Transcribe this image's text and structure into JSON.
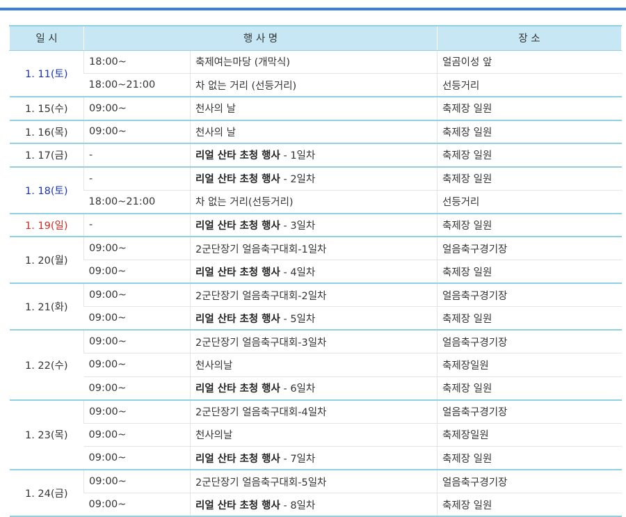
{
  "colors": {
    "header_bg": "#c6e7f3",
    "accent_bar": "#3d7ed6",
    "group_line": "#8fd0e3",
    "saturday": "#1a33bb",
    "sunday": "#d7261e"
  },
  "header": {
    "date": "일 시",
    "event": "행 사 명",
    "place": "장 소"
  },
  "groups": [
    {
      "date": "1. 11(토)",
      "day": "sat",
      "rows": [
        {
          "time": "18:00~",
          "event": "축제여는마당 (개막식)",
          "suffix": "",
          "place": "얼곰이성 앞"
        },
        {
          "time": "18:00~21:00",
          "event": "차 없는 거리 (선등거리)",
          "suffix": "",
          "place": "선등거리"
        }
      ]
    },
    {
      "date": "1. 15(수)",
      "day": "",
      "rows": [
        {
          "time": "09:00~",
          "event": "천사의 날",
          "suffix": "",
          "place": "축제장 일원"
        }
      ]
    },
    {
      "date": "1. 16(목)",
      "day": "",
      "rows": [
        {
          "time": "09:00~",
          "event": "천사의 날",
          "suffix": "",
          "place": "축제장 일원"
        }
      ]
    },
    {
      "date": "1. 17(금)",
      "day": "",
      "rows": [
        {
          "time": "-",
          "event": "리얼 산타 초청 행사",
          "suffix": " - 1일차",
          "place": "축제장 일원"
        }
      ]
    },
    {
      "date": "1. 18(토)",
      "day": "sat",
      "rows": [
        {
          "time": "-",
          "event": "리얼 산타 초청 행사",
          "suffix": " - 2일차",
          "place": "축제장 일원"
        },
        {
          "time": "18:00~21:00",
          "event": "차 없는 거리(선등거리)",
          "suffix": "",
          "place": "선등거리"
        }
      ]
    },
    {
      "date": "1. 19(일)",
      "day": "sun",
      "rows": [
        {
          "time": "-",
          "event": "리얼 산타 초청 행사",
          "suffix": " - 3일차",
          "place": "축제장 일원"
        }
      ]
    },
    {
      "date": "1. 20(월)",
      "day": "",
      "rows": [
        {
          "time": "09:00~",
          "event": "2군단장기 얼음축구대회-1일차",
          "suffix": "",
          "place": "얼음축구경기장"
        },
        {
          "time": "09:00~",
          "event": "리얼 산타 초청 행사",
          "suffix": " - 4일차",
          "place": "축제장 일원"
        }
      ]
    },
    {
      "date": "1. 21(화)",
      "day": "",
      "rows": [
        {
          "time": "09:00~",
          "event": "2군단장기 얼음축구대회-2일차",
          "suffix": "",
          "place": "얼음축구경기장"
        },
        {
          "time": "09:00~",
          "event": "리얼 산타 초청 행사",
          "suffix": " - 5일차",
          "place": "축제장 일원"
        }
      ]
    },
    {
      "date": "1. 22(수)",
      "day": "",
      "rows": [
        {
          "time": "09:00~",
          "event": "2군단장기 얼음축구대회-3일차",
          "suffix": "",
          "place": "얼음축구경기장"
        },
        {
          "time": "09:00~",
          "event": "천사의날",
          "suffix": "",
          "place": "축제장일원"
        },
        {
          "time": "09:00~",
          "event": "리얼 산타 초청 행사",
          "suffix": " - 6일차",
          "place": "축제장 일원"
        }
      ]
    },
    {
      "date": "1. 23(목)",
      "day": "",
      "rows": [
        {
          "time": "09:00~",
          "event": "2군단장기 얼음축구대회-4일차",
          "suffix": "",
          "place": "얼음축구경기장"
        },
        {
          "time": "09:00~",
          "event": "천사의날",
          "suffix": "",
          "place": "축제장일원"
        },
        {
          "time": "09:00~",
          "event": "리얼 산타 초청 행사",
          "suffix": " - 7일차",
          "place": "축제장 일원"
        }
      ]
    },
    {
      "date": "1. 24(금)",
      "day": "",
      "rows": [
        {
          "time": "09:00~",
          "event": "2군단장기 얼음축구대회-5일차",
          "suffix": "",
          "place": "얼음축구경기장"
        },
        {
          "time": "09:00~",
          "event": "리얼 산타 초청 행사",
          "suffix": " - 8일차",
          "place": "축제장 일원"
        }
      ]
    }
  ]
}
